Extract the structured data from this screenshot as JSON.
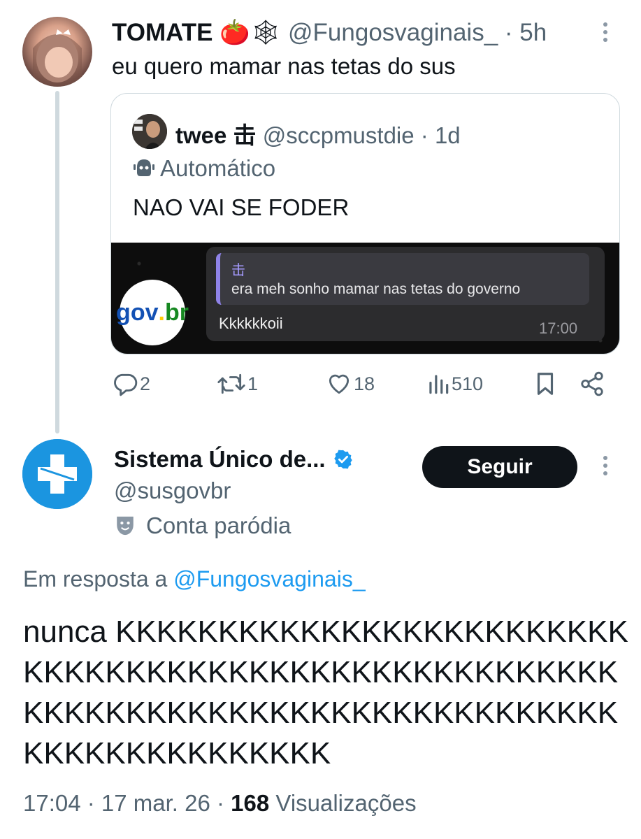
{
  "parent_tweet": {
    "display_name": "TOMATE",
    "name_emojis": "🍅🕸",
    "handle": "@Fungosvaginais_",
    "time_sep": " · ",
    "time": "5h",
    "text": "eu quero mamar nas tetas do sus"
  },
  "quoted_tweet": {
    "display_name": "twee",
    "name_symbol": "击",
    "handle": "@sccpmustdie",
    "time_sep": " · ",
    "time": "1d",
    "label": "Automático",
    "text": "NAO VAI SE FODER",
    "image": {
      "logo_text_gov": "gov",
      "logo_text_br": "br",
      "reply_symbol": "击",
      "reply_text": "era meh sonho mamar nas tetas do governo",
      "message": "Kkkkkkoii",
      "message_time": "17:00"
    }
  },
  "actions": {
    "replies": "2",
    "retweets": "1",
    "likes": "18",
    "views": "510"
  },
  "main_tweet": {
    "display_name": "Sistema Único de...",
    "handle": "@susgovbr",
    "label": "Conta paródia",
    "follow_label": "Seguir",
    "reply_prefix": "Em resposta a ",
    "reply_handle": "@Fungosvaginais_",
    "text": "nunca KKKKKKKKKKKKKKKKKKKKKKKKKKKKKKKKKKKKKKKKKKKKKKKKKKKKKKKKKKKKKKKKKKKKKKKKKKKKKKKKKKKKKKKKKKKKKKKKKK",
    "timestamp": "17:04 · 17 mar. 26 · ",
    "views_count": "168",
    "views_label": " Visualizações"
  },
  "colors": {
    "link": "#1d9bf0",
    "muted": "#536471",
    "verified": "#1d9bf0",
    "sus_blue": "#1b95e0"
  }
}
